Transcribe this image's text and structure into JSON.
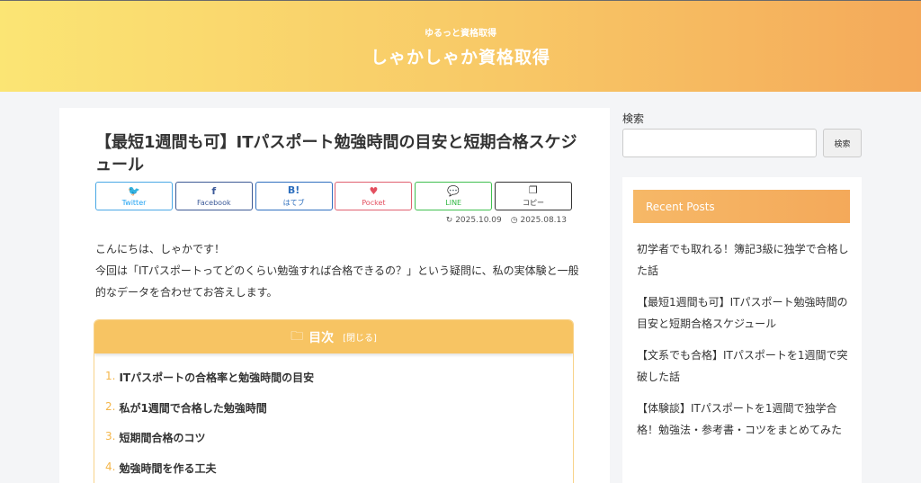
{
  "header": {
    "tagline": "ゆるっと資格取得",
    "site_title": "しゃかしゃか資格取得"
  },
  "article": {
    "title": "【最短1週間も可】ITパスポート勉強時間の目安と短期合格スケジュール",
    "share": [
      {
        "id": "twitter",
        "icon": "twitter-icon",
        "glyph": "🐦",
        "label": "Twitter",
        "color": "#1da1f2"
      },
      {
        "id": "facebook",
        "icon": "facebook-icon",
        "glyph": "f",
        "label": "Facebook",
        "color": "#3b5998"
      },
      {
        "id": "hatena",
        "icon": "hatena-icon",
        "glyph": "B!",
        "label": "はてブ",
        "color": "#2c6ebd"
      },
      {
        "id": "pocket",
        "icon": "pocket-icon",
        "glyph": "♥",
        "label": "Pocket",
        "color": "#e34f5f"
      },
      {
        "id": "line",
        "icon": "line-icon",
        "glyph": "💬",
        "label": "LINE",
        "color": "#33b845"
      },
      {
        "id": "copy",
        "icon": "copy-icon",
        "glyph": "❐",
        "label": "コピー",
        "color": "#333333"
      }
    ],
    "updated_date": "2025.10.09",
    "published_date": "2025.08.13",
    "intro_line1": "こんにちは、しゃかです！",
    "intro_line2": "今回は「ITパスポートってどのくらい勉強すれば合格できるの？」という疑問に、私の実体験と一般的なデータを合わせてお答えします。"
  },
  "toc": {
    "title": "目次",
    "toggle_label": "[閉じる]",
    "items": [
      {
        "num": "1.",
        "label": "ITパスポートの合格率と勉強時間の目安"
      },
      {
        "num": "2.",
        "label": "私が1週間で合格した勉強時間"
      },
      {
        "num": "3.",
        "label": "短期間合格のコツ"
      },
      {
        "num": "4.",
        "label": "勉強時間を作る工夫"
      }
    ]
  },
  "sidebar": {
    "search_label": "検索",
    "search_placeholder": "",
    "search_button": "検索",
    "recent_title": "Recent Posts",
    "recent_posts": [
      "初学者でも取れる！簿記3級に独学で合格した話",
      "【最短1週間も可】ITパスポート勉強時間の目安と短期合格スケジュール",
      "【文系でも合格】ITパスポートを1週間で突破した話",
      "【体験談】ITパスポートを1週間で独学合格！勉強法・参考書・コツをまとめてみた"
    ]
  },
  "colors": {
    "header_gradient_start": "#fbe574",
    "header_gradient_end": "#f4a95a",
    "toc_accent": "#f7c463"
  }
}
